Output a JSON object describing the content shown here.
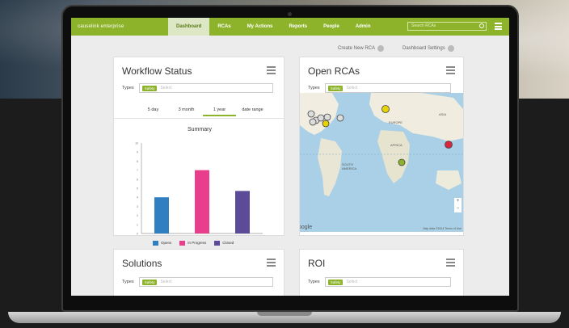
{
  "nav": {
    "brand": "causelink enterprise",
    "items": [
      "Dashboard",
      "RCAs",
      "My Actions",
      "Reports",
      "People",
      "Admin"
    ],
    "search_placeholder": "Search RCAs"
  },
  "actions": {
    "create": "Create New RCA",
    "settings": "Dashboard Settings"
  },
  "workflow": {
    "title": "Workflow Status",
    "types_label": "Types",
    "chip": "Safety",
    "select_placeholder": "Select",
    "tabs": [
      "5 day",
      "3 month",
      "1 year",
      "date range"
    ],
    "active_tab": "1 year",
    "chart_title": "Summary"
  },
  "open_rcas": {
    "title": "Open RCAs",
    "types_label": "Types",
    "chip": "Safety",
    "select_placeholder": "Select",
    "map": {
      "labels": [
        "EUROPE",
        "ASIA",
        "AFRICA",
        "SOUTH AMERICA"
      ],
      "credit": "Map data ©2014",
      "terms": "Terms of Use",
      "google": "oogle"
    }
  },
  "solutions": {
    "title": "Solutions",
    "types_label": "Types",
    "chip": "Safety",
    "select_placeholder": "Select"
  },
  "roi": {
    "title": "ROI",
    "types_label": "Types",
    "chip": "Safety",
    "select_placeholder": "Select"
  },
  "colors": {
    "accent": "#8db32b",
    "open": "#2f7fc1",
    "in_progress": "#e83e8c",
    "closed": "#5b4b99"
  },
  "chart_data": {
    "type": "bar",
    "title": "Summary",
    "categories": [
      "Opens",
      "In Progress",
      "Closed"
    ],
    "values": [
      4,
      7,
      4.7
    ],
    "ylim": [
      0,
      10
    ],
    "yticks": [
      0,
      1,
      2,
      3,
      4,
      5,
      6,
      7,
      8,
      9,
      10
    ],
    "legend": [
      "Opens",
      "In Progress",
      "Closed"
    ]
  }
}
